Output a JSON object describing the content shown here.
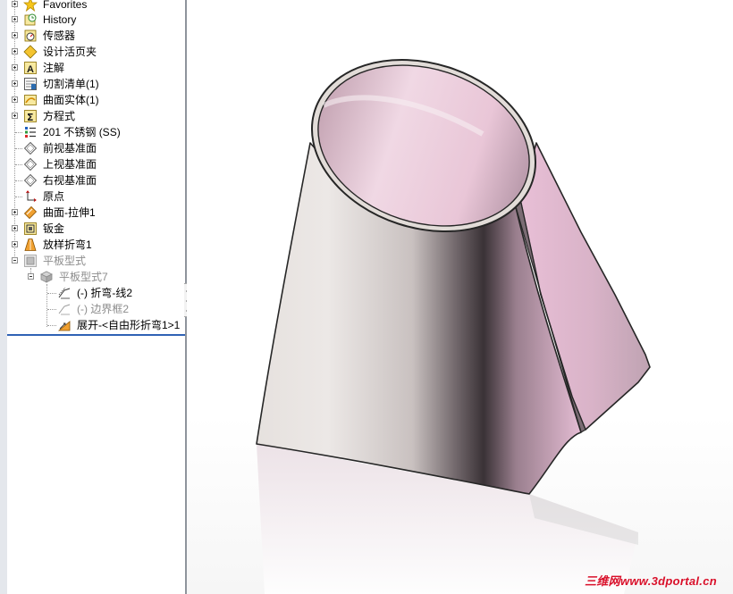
{
  "feature_tree": {
    "items": [
      {
        "label": "Favorites",
        "icon": "favorites-star-icon",
        "expandable": true,
        "dim": false
      },
      {
        "label": "History",
        "icon": "history-icon",
        "expandable": true,
        "dim": false
      },
      {
        "label": "传感器",
        "icon": "sensor-icon",
        "expandable": true,
        "dim": false
      },
      {
        "label": "设计活页夹",
        "icon": "design-binder-icon",
        "expandable": true,
        "dim": false
      },
      {
        "label": "注解",
        "icon": "annotation-icon",
        "expandable": true,
        "dim": false
      },
      {
        "label": "切割清单(1)",
        "icon": "cut-list-icon",
        "expandable": true,
        "dim": false
      },
      {
        "label": "曲面实体(1)",
        "icon": "surface-bodies-icon",
        "expandable": true,
        "dim": false
      },
      {
        "label": "方程式",
        "icon": "equations-icon",
        "expandable": true,
        "dim": false
      },
      {
        "label": "201 不锈钢 (SS)",
        "icon": "material-icon",
        "expandable": false,
        "dim": false
      },
      {
        "label": "前视基准面",
        "icon": "plane-icon",
        "expandable": false,
        "dim": false
      },
      {
        "label": "上视基准面",
        "icon": "plane-icon",
        "expandable": false,
        "dim": false
      },
      {
        "label": "右视基准面",
        "icon": "plane-icon",
        "expandable": false,
        "dim": false
      },
      {
        "label": "原点",
        "icon": "origin-icon",
        "expandable": false,
        "dim": false
      },
      {
        "label": "曲面-拉伸1",
        "icon": "surface-extrude-icon",
        "expandable": true,
        "dim": false
      },
      {
        "label": "钣金",
        "icon": "sheet-metal-icon",
        "expandable": true,
        "dim": false
      },
      {
        "label": "放样折弯1",
        "icon": "lofted-bend-icon",
        "expandable": true,
        "dim": false
      },
      {
        "label": "平板型式",
        "icon": "flat-pattern-folder-icon",
        "expandable": true,
        "dim": true
      },
      {
        "label": "平板型式7",
        "icon": "flat-pattern-icon",
        "expandable": true,
        "dim": true
      },
      {
        "label": "(-) 折弯-线2",
        "icon": "bend-lines-sketch-icon",
        "expandable": false,
        "dim": false
      },
      {
        "label": "(-) 边界框2",
        "icon": "bounding-box-sketch-icon",
        "expandable": false,
        "dim": true
      },
      {
        "label": "展开-<自由形折弯1>1",
        "icon": "unfold-icon",
        "expandable": false,
        "dim": false
      }
    ]
  },
  "viewport": {
    "model_description_colors": {
      "outer": "#e9e4e2",
      "inner": "#e6bed4",
      "edge": "#262626"
    }
  },
  "watermark": "三维网www.3dportal.cn"
}
